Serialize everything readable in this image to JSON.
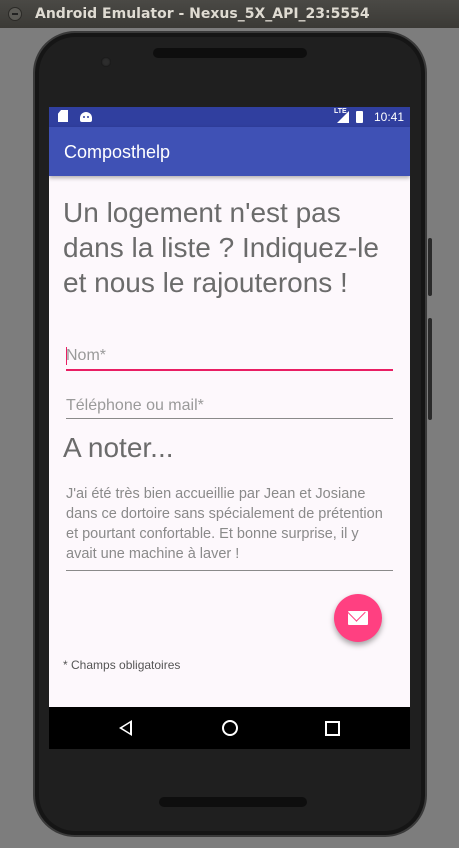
{
  "window": {
    "title": "Android Emulator - Nexus_5X_API_23:5554"
  },
  "status_bar": {
    "time": "10:41",
    "network": "LTE"
  },
  "app_bar": {
    "title": "Composthelp"
  },
  "form": {
    "headline": "Un logement n'est pas dans la liste ? Indiquez-le et nous le rajouterons !",
    "name_field": {
      "placeholder": "Nom*",
      "value": ""
    },
    "contact_field": {
      "placeholder": "Téléphone ou mail*",
      "value": ""
    },
    "note_title": "A noter...",
    "note_field": {
      "value": "J'ai été très bien accueillie par Jean et Josiane dans ce dortoire sans spécialement de prétention et pourtant confortable. Et bonne surprise, il y avait une machine à laver !"
    },
    "footnote": "* Champs obligatoires"
  },
  "fab": {
    "icon": "mail-icon",
    "color": "#ff4081"
  },
  "colors": {
    "primary": "#3f51b5",
    "primary_dark": "#303f9f",
    "accent": "#e91e63"
  },
  "nav_bar": {
    "icons": [
      "back-icon",
      "home-icon",
      "recents-icon"
    ]
  }
}
